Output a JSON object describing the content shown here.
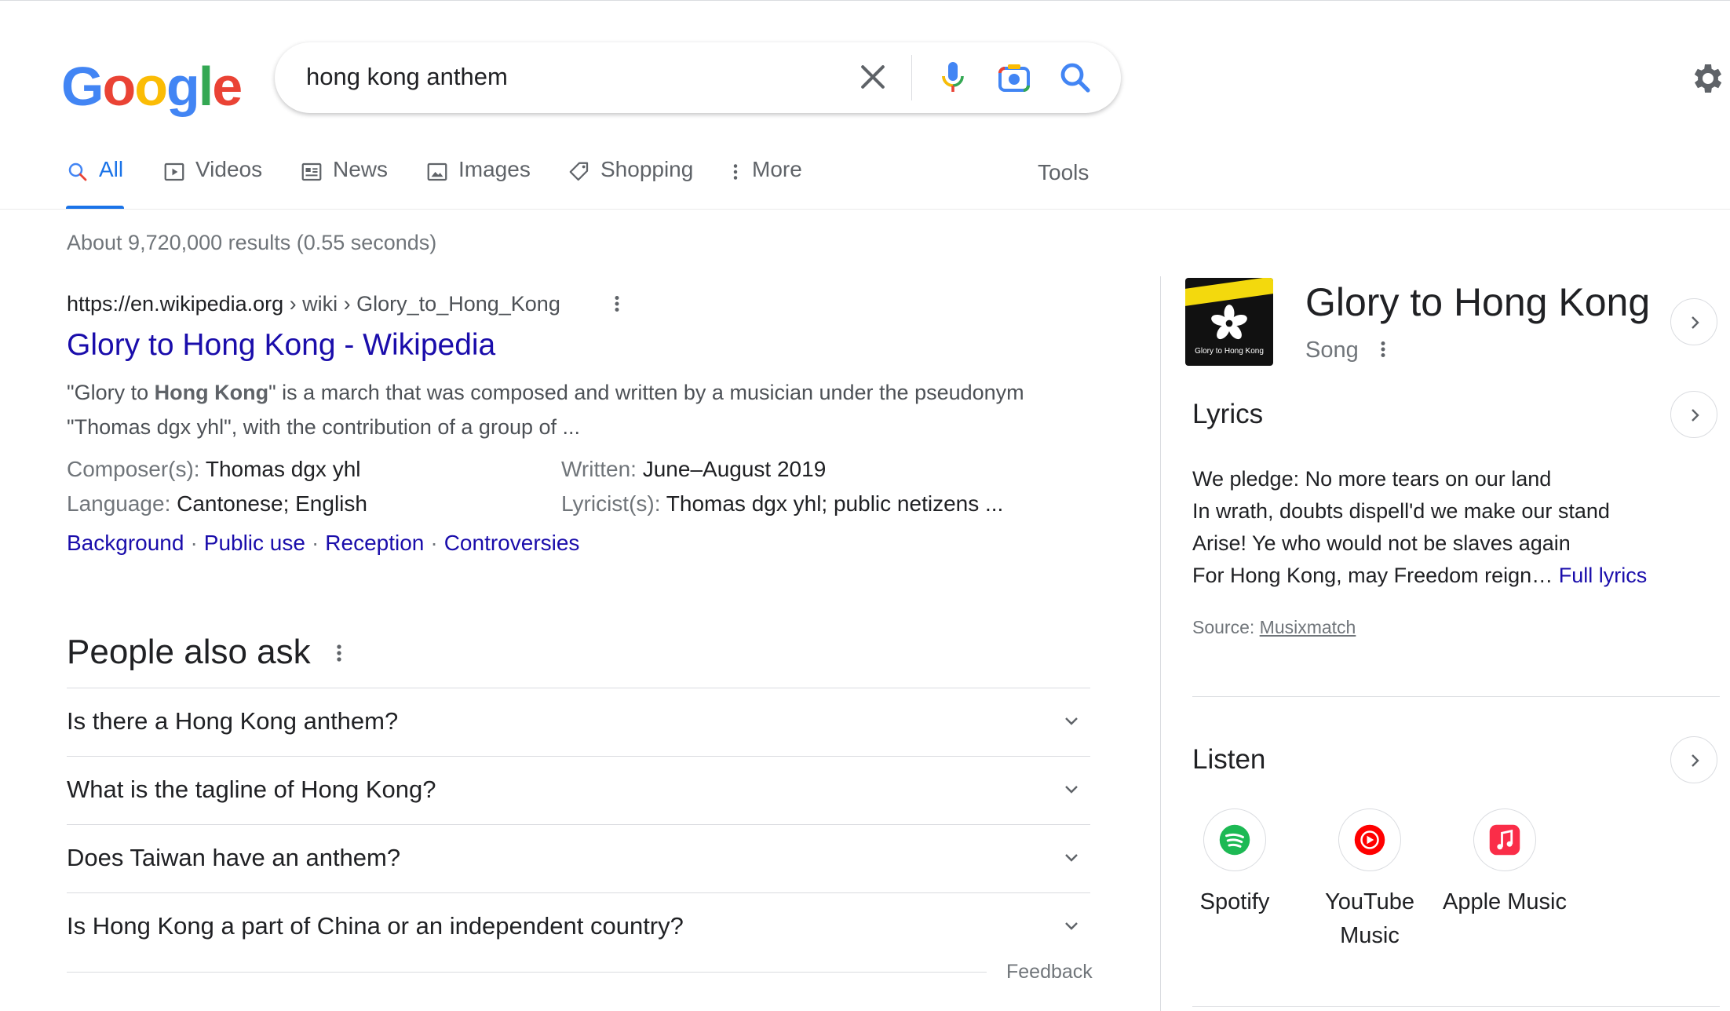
{
  "brand": {
    "logo_letters": [
      "G",
      "o",
      "o",
      "g",
      "l",
      "e"
    ],
    "colors": {
      "blue": "#4285f4",
      "red": "#ea4335",
      "yellow": "#fbbc05",
      "green": "#34a853",
      "link": "#1a0dab",
      "accent": "#1a73e8"
    }
  },
  "search": {
    "query": "hong kong anthem",
    "icons": [
      "close-icon",
      "mic-icon",
      "lens-icon",
      "search-icon"
    ]
  },
  "tabs": [
    {
      "label": "All",
      "icon": "search-icon",
      "active": true
    },
    {
      "label": "Videos",
      "icon": "play-icon"
    },
    {
      "label": "News",
      "icon": "news-icon"
    },
    {
      "label": "Images",
      "icon": "image-icon"
    },
    {
      "label": "Shopping",
      "icon": "tag-icon"
    },
    {
      "label": "More",
      "icon": "more-vert-icon"
    }
  ],
  "tools_label": "Tools",
  "stats": "About 9,720,000 results (0.55 seconds)",
  "result": {
    "url_domain": "https://en.wikipedia.org",
    "url_path": " › wiki › Glory_to_Hong_Kong",
    "title": "Glory to Hong Kong - Wikipedia",
    "snippet_a": "\"Glory to ",
    "snippet_bold": "Hong Kong",
    "snippet_b": "\" is a march that was composed and written by a musician under the pseudonym \"Thomas dgx yhl\", with the contribution of a group of ...",
    "facts": [
      {
        "key": "Composer(s): ",
        "value": "Thomas dgx yhl"
      },
      {
        "key": "Written: ",
        "value": "June–August 2019"
      },
      {
        "key": "Language: ",
        "value": "Cantonese; English"
      },
      {
        "key": "Lyricist(s): ",
        "value": "Thomas dgx yhl; public netizens ..."
      }
    ],
    "sitelinks": [
      "Background",
      "Public use",
      "Reception",
      "Controversies"
    ],
    "sitelink_separator": "·"
  },
  "paa": {
    "title": "People also ask",
    "questions": [
      "Is there a Hong Kong anthem?",
      "What is the tagline of Hong Kong?",
      "Does Taiwan have an anthem?",
      "Is Hong Kong a part of China or an independent country?"
    ],
    "feedback": "Feedback"
  },
  "panel": {
    "title": "Glory to Hong Kong",
    "subtitle": "Song",
    "thumb_caption": "Glory to Hong Kong",
    "lyrics_heading": "Lyrics",
    "lyrics_lines": [
      "We pledge: No more tears on our land",
      "In wrath, doubts dispell'd we make our stand",
      "Arise! Ye who would not be slaves again",
      "For Hong Kong, may Freedom reign…"
    ],
    "full_lyrics": "Full lyrics",
    "source_label": "Source: ",
    "source_name": "Musixmatch",
    "listen_heading": "Listen",
    "services": [
      {
        "label": "Spotify",
        "icon": "spotify-icon",
        "color": "#1db954"
      },
      {
        "label": "YouTube Music",
        "icon": "youtube-music-icon",
        "color": "#ff0000"
      },
      {
        "label": "Apple Music",
        "icon": "apple-music-icon",
        "color": "#fa2d48"
      }
    ]
  }
}
